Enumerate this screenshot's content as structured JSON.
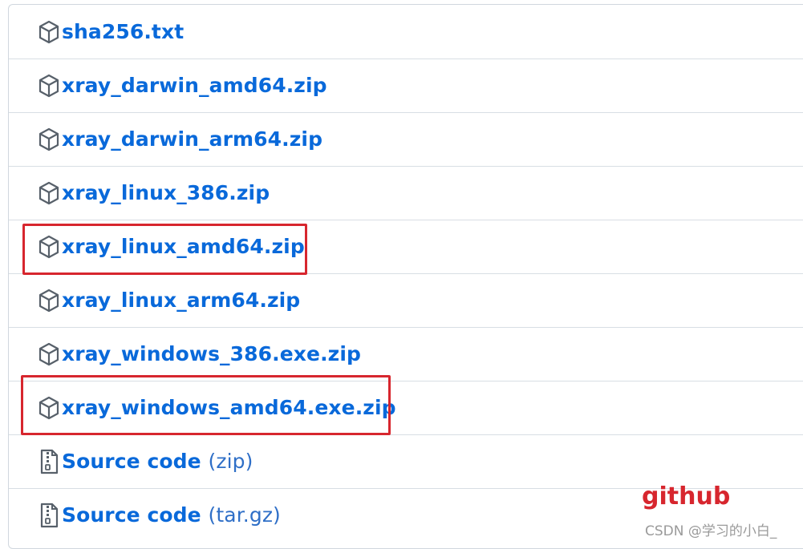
{
  "assets": [
    {
      "name": "sha256.txt",
      "icon": "package-icon"
    },
    {
      "name": "xray_darwin_amd64.zip",
      "icon": "package-icon"
    },
    {
      "name": "xray_darwin_arm64.zip",
      "icon": "package-icon"
    },
    {
      "name": "xray_linux_386.zip",
      "icon": "package-icon"
    },
    {
      "name": "xray_linux_amd64.zip",
      "icon": "package-icon"
    },
    {
      "name": "xray_linux_arm64.zip",
      "icon": "package-icon"
    },
    {
      "name": "xray_windows_386.exe.zip",
      "icon": "package-icon"
    },
    {
      "name": "xray_windows_amd64.exe.zip",
      "icon": "package-icon"
    },
    {
      "name": "Source code",
      "suffix": "(zip)",
      "icon": "file-zip-icon"
    },
    {
      "name": "Source code",
      "suffix": "(tar.gz)",
      "icon": "file-zip-icon"
    }
  ],
  "annotation": {
    "label": "github",
    "watermark": "CSDN @学习的小白_",
    "highlight_color": "#d7262e",
    "link_color": "#0969da"
  }
}
